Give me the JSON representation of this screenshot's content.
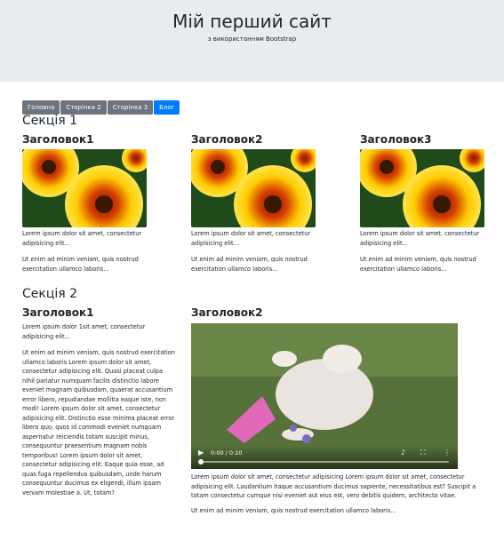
{
  "header": {
    "title": "Мій перший сайт",
    "subtitle": "з використанням Bootstrap"
  },
  "nav": {
    "items": [
      {
        "label": "Головна",
        "active": false
      },
      {
        "label": "Сторінка 2",
        "active": false
      },
      {
        "label": "Сторінка 3",
        "active": false
      },
      {
        "label": "Блог",
        "active": true
      }
    ]
  },
  "section1": {
    "title": "Секція 1",
    "cards": [
      {
        "heading": "Заголовок1",
        "text1": "Lorem ipsum dolor sit amet, consectetur adipisicing elit...",
        "text2": "Ut enim ad minim veniam, quis nostrud exercitation ullamco laboris..."
      },
      {
        "heading": "Заголовок2",
        "text1": "Lorem ipsum dolor sit amet, consectetur adipisicing elit...",
        "text2": "Ut enim ad minim veniam, quis nostrud exercitation ullamco laboris..."
      },
      {
        "heading": "Заголовок3",
        "text1": "Lorem ipsum dolor sit amet, consectetur adipisicing elit...",
        "text2": "Ut enim ad minim veniam, quis nostrud exercitation ullamco laboris..."
      }
    ]
  },
  "section2": {
    "title": "Секція 2",
    "left": {
      "heading": "Заголовок1",
      "text1": "Lorem ipsum dolor 1sit amet, consectetur adipisicing elit...",
      "text2": "Ut enim ad minim veniam, quis nostrud exercitation ullamco laboris Lorem ipsum dolor sit amet, consectetur adipisicing elit. Quasi placeat culpa nihil pariatur numquam facilis distinctio labore eveniet magnam quibusdam, quaerat accusantium error libero, repudiandae mollitia eaque iste, non modi! Lorem ipsum dolor sit amet, consectetur adipisicing elit. Distinctio esse minima placeat error libero quo, quos id commodi eveniet numquam aspernatur reiciendis totam suscipit minus, consequuntur praesentium magnam nobis temporibus! Lorem ipsum dolor sit amet, consectetur adipisicing elit. Eaque quia esse, ad quas fuga repellendus quibusdam, unde harum consequuntur ducimus ex eligendi, illum ipsam veniam molestiae a. Ut, totam?"
    },
    "right": {
      "heading": "Заголовок2",
      "video": {
        "time": "0:00 / 0:10"
      },
      "text1": "Lorem ipsum dolor sit amet, consectetur adipisicing Lorem ipsum dolor sit amet, consectetur adipisicing elit. Laudantium itaque accusantium ducimus sapiente, necessitatibus est? Suscipit a totam consectetur cumque nisi eveniet aut eius est, vero debitis quidem, architecto vitae.",
      "text2": "Ut enim ad minim veniam, quis nostrud exercitation ullamco laboris..."
    }
  },
  "colors": {
    "jumbotron": "#e9ecef",
    "nav_default": "#6c757d",
    "nav_active": "#007bff"
  },
  "icons": {
    "play": "play-icon",
    "volume": "volume-icon",
    "fullscreen": "fullscreen-icon",
    "menu": "more-icon"
  }
}
